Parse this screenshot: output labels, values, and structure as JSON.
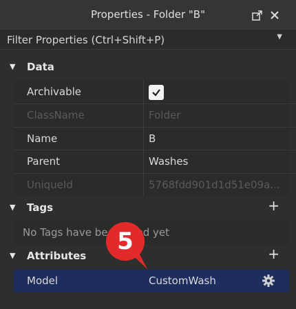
{
  "window": {
    "title": "Properties - Folder \"B\"",
    "icons": [
      "undock-icon",
      "close-icon"
    ]
  },
  "filter": {
    "placeholder": "Filter Properties (Ctrl+Shift+P)"
  },
  "sections": {
    "data": {
      "label": "Data",
      "properties": [
        {
          "name": "Archivable",
          "value": "",
          "checked": true
        },
        {
          "name": "ClassName",
          "value": "Folder",
          "readonly": true
        },
        {
          "name": "Name",
          "value": "B"
        },
        {
          "name": "Parent",
          "value": "Washes"
        },
        {
          "name": "UniqueId",
          "value": "5768fdd901d1d51e09a...",
          "readonly": true
        }
      ]
    },
    "tags": {
      "label": "Tags",
      "empty_text": "No Tags have be",
      "empty_text_tail": "ed yet"
    },
    "attributes": {
      "label": "Attributes",
      "properties": [
        {
          "name": "Model",
          "value": "CustomWash"
        }
      ]
    }
  },
  "annotation": {
    "badge": "5",
    "color": "#e32a2a"
  }
}
